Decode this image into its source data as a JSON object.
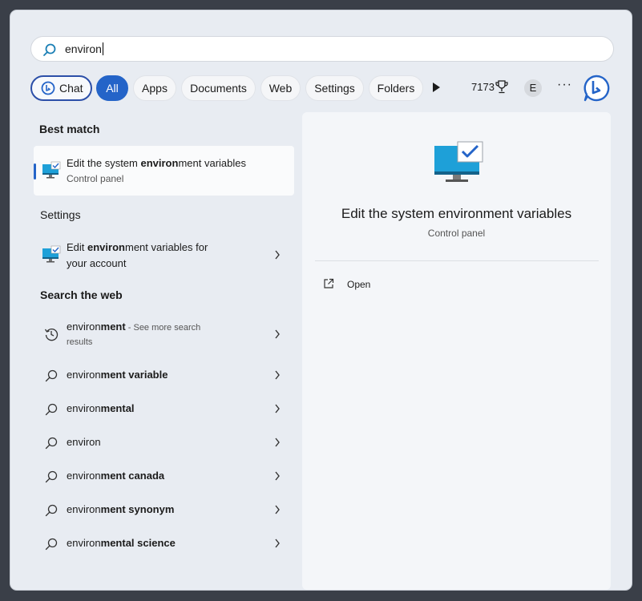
{
  "search": {
    "query": "environ"
  },
  "filters": {
    "chat_label": "Chat",
    "tabs": [
      "All",
      "Apps",
      "Documents",
      "Web",
      "Settings",
      "Folders"
    ],
    "points": "7173",
    "avatar_initial": "E",
    "more": "···"
  },
  "best_match": {
    "heading": "Best match",
    "title_pre": "Edit the system ",
    "title_bold": "environ",
    "title_post": "ment variables",
    "subtitle": "Control panel"
  },
  "settings": {
    "heading": "Settings",
    "item_pre": "Edit ",
    "item_bold": "environ",
    "item_post": "ment variables for",
    "item_line2": "your account"
  },
  "web": {
    "heading": "Search the web",
    "first": {
      "plain": "environ",
      "bold": "ment",
      "suffix": " - See more search",
      "suffix2": "results"
    },
    "items": [
      {
        "plain": "environ",
        "bold": "ment variable"
      },
      {
        "plain": "environ",
        "bold": "mental"
      },
      {
        "plain": "environ",
        "bold": ""
      },
      {
        "plain": "environ",
        "bold": "ment canada"
      },
      {
        "plain": "environ",
        "bold": "ment synonym"
      },
      {
        "plain": "environ",
        "bold": "mental science"
      }
    ]
  },
  "preview": {
    "title": "Edit the system environment variables",
    "subtitle": "Control panel",
    "open_label": "Open"
  },
  "colors": {
    "accent": "#2464c8",
    "panel": "#e8ecf2"
  }
}
